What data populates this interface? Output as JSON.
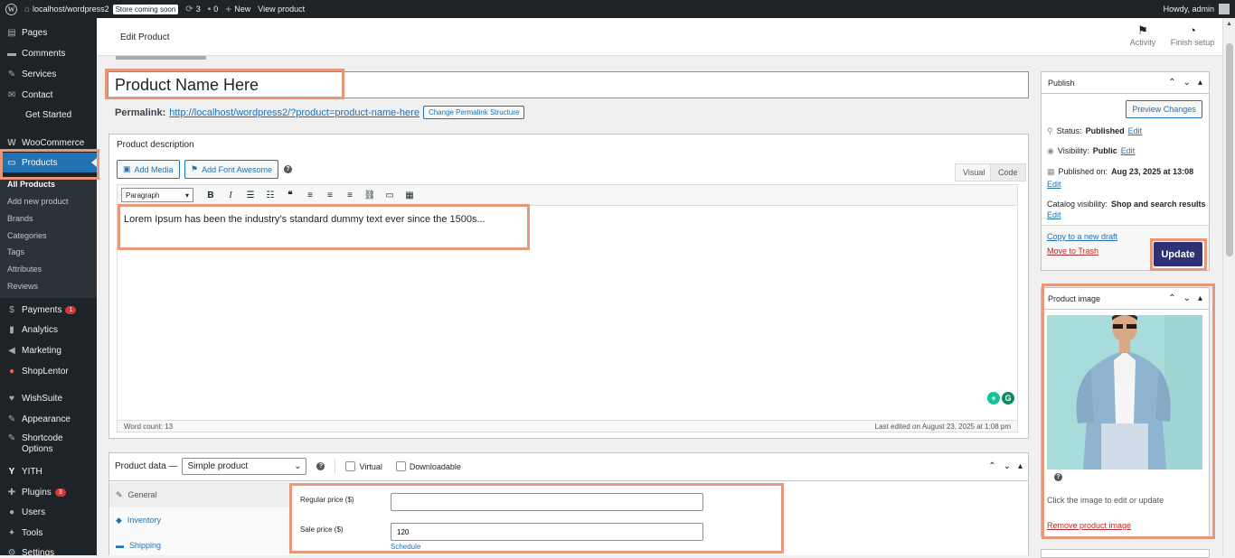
{
  "adminbar": {
    "site": "localhost/wordpress2",
    "store_badge": "Store coming soon",
    "updates": "3",
    "comments": "0",
    "new": "New",
    "view": "View product",
    "howdy": "Howdy, admin"
  },
  "sidebar": {
    "items": [
      {
        "label": "Pages",
        "icon": "pages-icon"
      },
      {
        "label": "Comments",
        "icon": "comments-icon"
      },
      {
        "label": "Services",
        "icon": "services-icon"
      },
      {
        "label": "Contact",
        "icon": "contact-icon"
      },
      {
        "label": "Get Started",
        "icon": ""
      },
      {
        "label": "WooCommerce",
        "icon": "woo-icon"
      },
      {
        "label": "Products",
        "icon": "products-icon"
      },
      {
        "label": "Payments",
        "icon": "payments-icon",
        "count": "1"
      },
      {
        "label": "Analytics",
        "icon": "analytics-icon"
      },
      {
        "label": "Marketing",
        "icon": "marketing-icon"
      },
      {
        "label": "ShopLentor",
        "icon": "shoplentor-icon"
      },
      {
        "label": "WishSuite",
        "icon": "wishsuite-icon"
      },
      {
        "label": "Appearance",
        "icon": "appearance-icon"
      },
      {
        "label": "Shortcode",
        "label2": "Options",
        "icon": "shortcode-icon"
      },
      {
        "label": "YITH",
        "icon": "yith-icon"
      },
      {
        "label": "Plugins",
        "icon": "plugins-icon",
        "count": "3"
      },
      {
        "label": "Users",
        "icon": "users-icon"
      },
      {
        "label": "Tools",
        "icon": "tools-icon"
      },
      {
        "label": "Settings",
        "icon": "settings-icon"
      }
    ],
    "submenu": [
      "All Products",
      "Add new product",
      "Brands",
      "Categories",
      "Tags",
      "Attributes",
      "Reviews"
    ]
  },
  "topbar": {
    "title": "Edit Product",
    "activity": "Activity",
    "finish_setup": "Finish setup"
  },
  "product": {
    "name": "Product Name Here",
    "permalink_label": "Permalink:",
    "permalink_url": "http://localhost/wordpress2/?product=product-name-here",
    "change_permalink": "Change Permalink Structure"
  },
  "editor": {
    "heading": "Product description",
    "add_media": "Add Media",
    "add_font_awesome": "Add Font Awesome",
    "tab_visual": "Visual",
    "tab_code": "Code",
    "format": "Paragraph",
    "content": "Lorem Ipsum has been the industry’s standard dummy text ever since the 1500s...",
    "word_count": "Word count: 13",
    "last_edited": "Last edited on August 23, 2025 at 1:08 pm"
  },
  "product_data": {
    "label": "Product data —",
    "type": "Simple product",
    "virtual": "Virtual",
    "downloadable": "Downloadable",
    "tabs": [
      "General",
      "Inventory",
      "Shipping"
    ],
    "regular_price_label": "Regular price ($)",
    "regular_price_value": "",
    "sale_price_label": "Sale price ($)",
    "sale_price_value": "120",
    "schedule": "Schedule"
  },
  "publish": {
    "heading": "Publish",
    "preview": "Preview Changes",
    "status_label": "Status:",
    "status_value": "Published",
    "visibility_label": "Visibility:",
    "visibility_value": "Public",
    "published_on_label": "Published on:",
    "published_on_value": "Aug 23, 2025 at 13:08",
    "catalog_label": "Catalog visibility:",
    "catalog_value": "Shop and search results",
    "edit": "Edit",
    "copy_draft": "Copy to a new draft",
    "trash": "Move to Trash",
    "update": "Update"
  },
  "product_image": {
    "heading": "Product image",
    "hint": "Click the image to edit or update",
    "remove": "Remove product image"
  },
  "colors": {
    "accent": "#2271b1",
    "highlight": "#e8977a",
    "update_button": "#2c3273"
  }
}
